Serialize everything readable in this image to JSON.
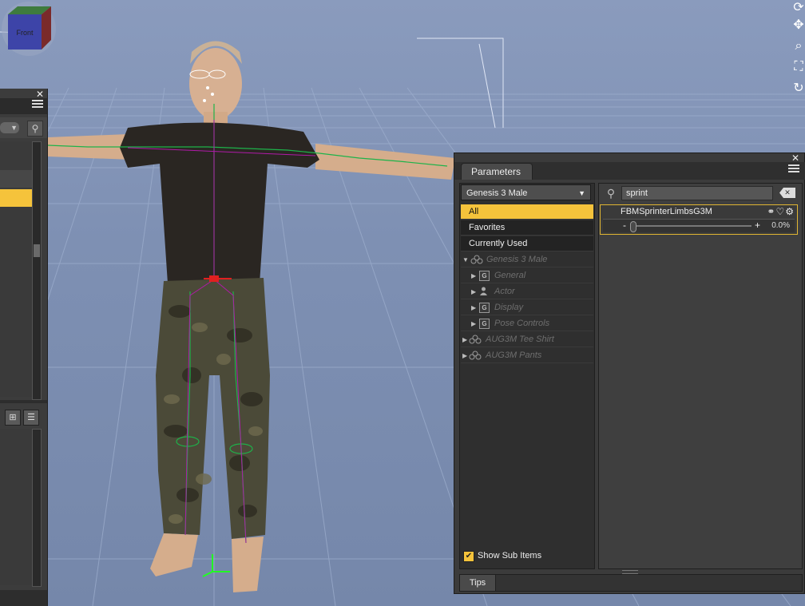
{
  "viewport": {
    "camera_label": "Front",
    "nav_icons": [
      "rotate-icon",
      "pan-icon",
      "zoom-icon",
      "frame-icon",
      "orbit-icon"
    ]
  },
  "left_pane": {
    "close_glyph": "✕",
    "view_buttons": [
      "grid-view-icon",
      "list-view-icon"
    ]
  },
  "parameters": {
    "close_glyph": "✕",
    "tab_label": "Parameters",
    "node_select": "Genesis 3 Male",
    "filters": [
      {
        "label": "All",
        "selected": true
      },
      {
        "label": "Favorites",
        "selected": false
      },
      {
        "label": "Currently Used",
        "selected": false
      }
    ],
    "tree": [
      {
        "label": "Genesis 3 Male",
        "icon": "figure-icon",
        "expanded": true,
        "level": 0
      },
      {
        "label": "General",
        "icon": "group-icon",
        "expanded": false,
        "level": 1
      },
      {
        "label": "Actor",
        "icon": "actor-icon",
        "expanded": false,
        "level": 1
      },
      {
        "label": "Display",
        "icon": "group-icon",
        "expanded": false,
        "level": 1
      },
      {
        "label": "Pose Controls",
        "icon": "group-icon",
        "expanded": false,
        "level": 1
      },
      {
        "label": "AUG3M Tee Shirt",
        "icon": "figure-icon",
        "expanded": false,
        "level": 0
      },
      {
        "label": "AUG3M Pants",
        "icon": "figure-icon",
        "expanded": false,
        "level": 0
      }
    ],
    "show_sub_items": {
      "label": "Show Sub Items",
      "checked": true
    },
    "search_value": "sprint",
    "property": {
      "name": "FBMSprinterLimbsG3M",
      "minus": "-",
      "plus": "+",
      "value_text": "0.0%",
      "value": 0.0
    },
    "tips_label": "Tips"
  },
  "colors": {
    "accent": "#f5c33b",
    "viewport_bg": "#7d8fb1",
    "panel_bg": "#3b3b3b"
  }
}
